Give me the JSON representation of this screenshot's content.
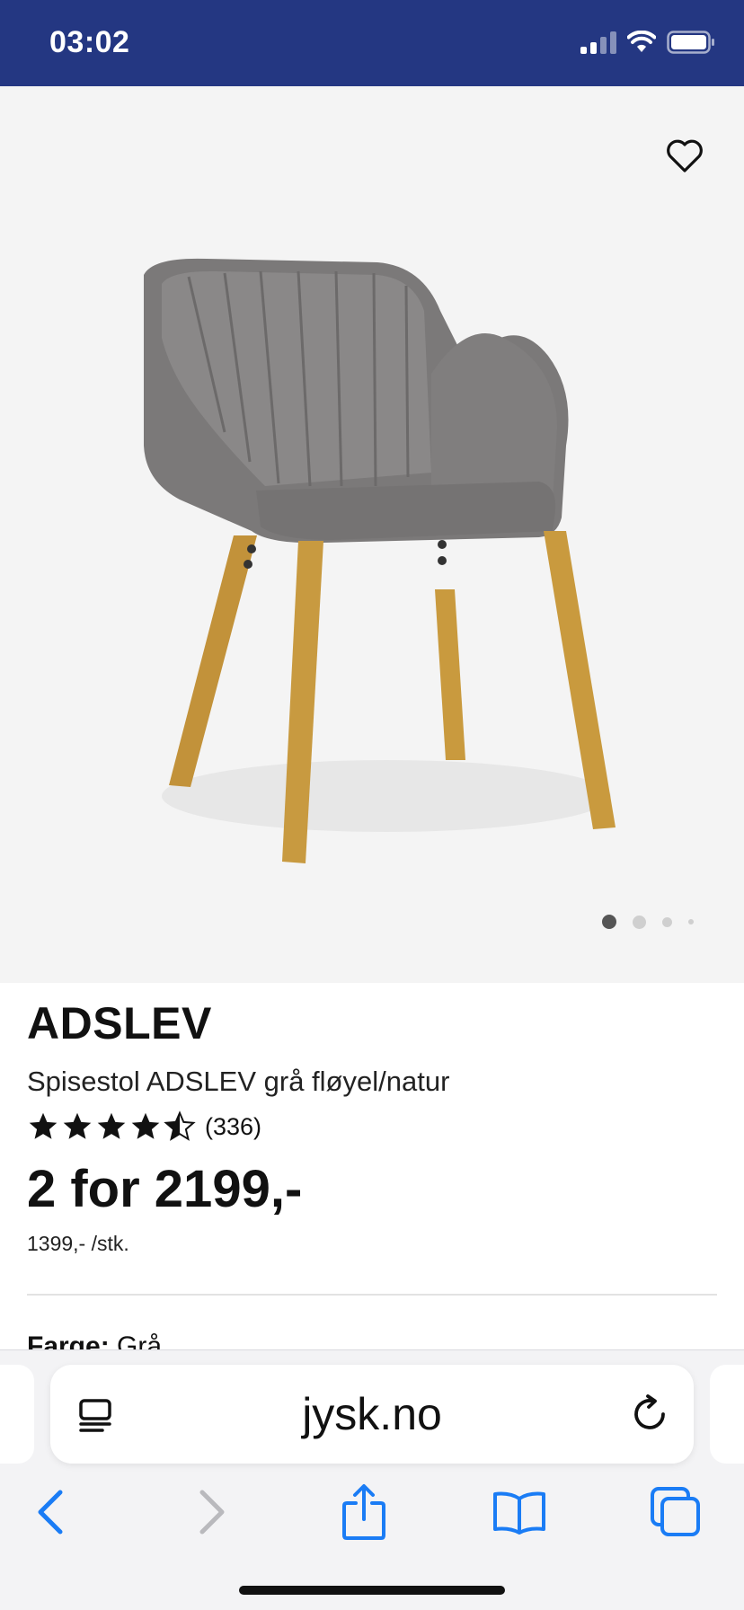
{
  "status_bar": {
    "time": "03:02",
    "background": "#243782",
    "icons": [
      "cellular-signal-icon",
      "wifi-icon",
      "battery-icon"
    ]
  },
  "product": {
    "image": "grey velvet dining chair with wooden legs",
    "favorite_icon": "heart-outline-icon",
    "carousel": {
      "count": 4,
      "active_index": 0
    },
    "brand": "ADSLEV",
    "description": "Spisestol ADSLEV grå fløyel/natur",
    "rating": {
      "value": 4.5,
      "max": 5,
      "reviews": "(336)"
    },
    "price": "2 for 2199,-",
    "unit_price": "1399,- /stk.",
    "attribute": {
      "label": "Farge:",
      "value": "Grå"
    }
  },
  "browser": {
    "url": "jysk.no",
    "accent": "#1a7cf5",
    "icons": {
      "reader": "reader-mode-icon",
      "reload": "reload-icon",
      "back": "back-chevron-icon",
      "forward": "forward-chevron-icon",
      "share": "share-icon",
      "bookmarks": "bookmarks-icon",
      "tabs": "tabs-icon"
    }
  }
}
